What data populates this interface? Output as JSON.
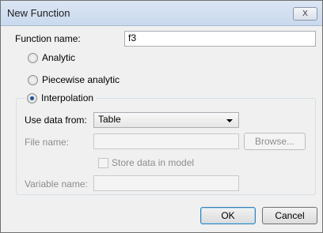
{
  "window": {
    "title": "New Function",
    "close_label": "X"
  },
  "form": {
    "function_name_label": "Function name:",
    "function_name_value": "f3",
    "radios": [
      {
        "label": "Analytic",
        "selected": false
      },
      {
        "label": "Piecewise analytic",
        "selected": false
      },
      {
        "label": "Interpolation",
        "selected": true
      }
    ],
    "use_data_from_label": "Use data from:",
    "use_data_from_value": "Table",
    "file_name_label": "File name:",
    "file_name_value": "",
    "browse_label": "Browse...",
    "store_data_label": "Store data in model",
    "variable_name_label": "Variable name:",
    "variable_name_value": ""
  },
  "buttons": {
    "ok_label": "OK",
    "cancel_label": "Cancel"
  }
}
